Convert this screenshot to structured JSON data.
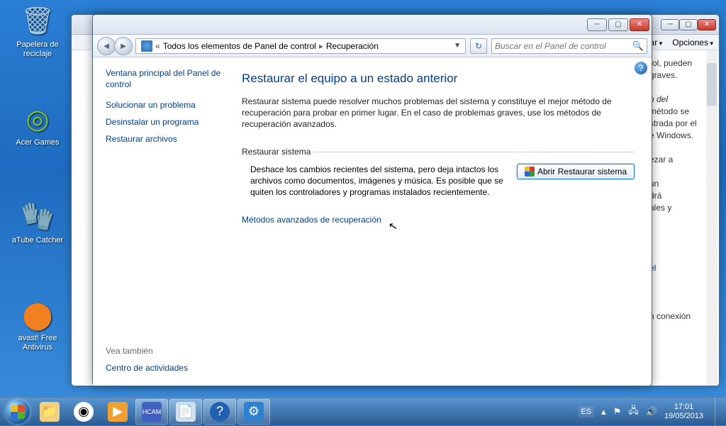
{
  "desktop": {
    "icons": [
      {
        "label": "Papelera de\nreciclaje"
      },
      {
        "label": "Acer Games"
      },
      {
        "label": "aTube Catcher"
      },
      {
        "label": "avast! Free\nAntivirus"
      }
    ]
  },
  "bgwindow": {
    "menu": {
      "help": "Ayudar",
      "options": "Opciones"
    },
    "snips": [
      "rol, pueden",
      "graves.",
      "n del",
      "método se",
      "strada por el",
      "e Windows.",
      "ezar a",
      "un",
      "drá",
      "ales y",
      "el",
      "n conexión"
    ]
  },
  "window": {
    "breadcrumb": {
      "root": "Todos los elementos de Panel de control",
      "current": "Recuperación"
    },
    "search_placeholder": "Buscar en el Panel de control",
    "sidebar": {
      "main": "Ventana principal del Panel de control",
      "links": [
        "Solucionar un problema",
        "Desinstalar un programa",
        "Restaurar archivos"
      ],
      "see_also": "Vea también",
      "activity": "Centro de actividades"
    },
    "main": {
      "title": "Restaurar el equipo a un estado anterior",
      "intro": "Restaurar sistema puede resolver muchos problemas del sistema y constituye el mejor método de recuperación para probar en primer lugar. En el caso de problemas graves, use los métodos de recuperación avanzados.",
      "section": "Restaurar sistema",
      "restore_text": "Deshace los cambios recientes del sistema, pero deja intactos los archivos como documentos, imágenes y música. Es posible que se quiten los controladores y programas instalados recientemente.",
      "open_button": "Abrir Restaurar sistema",
      "adv_link": "Métodos avanzados de recuperación"
    }
  },
  "taskbar": {
    "lang": "ES",
    "time": "17:01",
    "date": "19/05/2013"
  }
}
